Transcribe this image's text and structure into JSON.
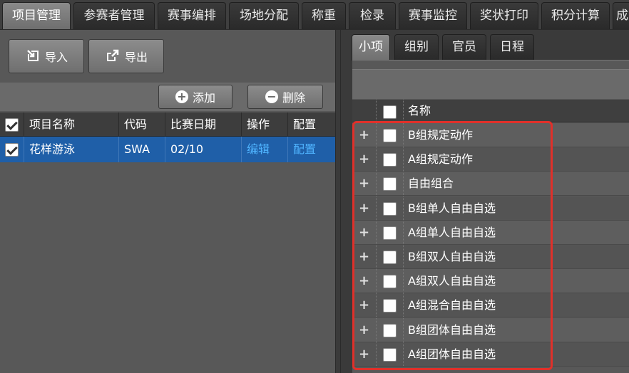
{
  "top_tabs": [
    {
      "label": "项目管理",
      "active": true
    },
    {
      "label": "参赛者管理",
      "active": false
    },
    {
      "label": "赛事编排",
      "active": false
    },
    {
      "label": "场地分配",
      "active": false
    },
    {
      "label": "称重",
      "active": false
    },
    {
      "label": "检录",
      "active": false
    },
    {
      "label": "赛事监控",
      "active": false
    },
    {
      "label": "奖状打印",
      "active": false
    },
    {
      "label": "积分计算",
      "active": false
    },
    {
      "label": "成",
      "active": false
    }
  ],
  "left": {
    "import_label": "导入",
    "export_label": "导出",
    "add_label": "添加",
    "delete_label": "删除",
    "columns": [
      "项目名称",
      "代码",
      "比赛日期",
      "操作",
      "配置"
    ],
    "rows": [
      {
        "name": "花样游泳",
        "code": "SWA",
        "date": "02/10",
        "action": "编辑",
        "config": "配置",
        "checked": true
      }
    ]
  },
  "right": {
    "sub_tabs": [
      {
        "label": "小项",
        "active": true
      },
      {
        "label": "组别",
        "active": false
      },
      {
        "label": "官员",
        "active": false
      },
      {
        "label": "日程",
        "active": false
      }
    ],
    "column_name": "名称",
    "items": [
      "B组规定动作",
      "A组规定动作",
      "自由组合",
      "B组单人自由自选",
      "A组单人自由自选",
      "B组双人自由自选",
      "A组双人自由自选",
      "A组混合自由自选",
      "B组团体自由自选",
      "A组团体自由自选"
    ]
  },
  "colors": {
    "selected_row": "#1f5fa8",
    "link": "#4fb4ff",
    "highlight_border": "#e0302a"
  }
}
